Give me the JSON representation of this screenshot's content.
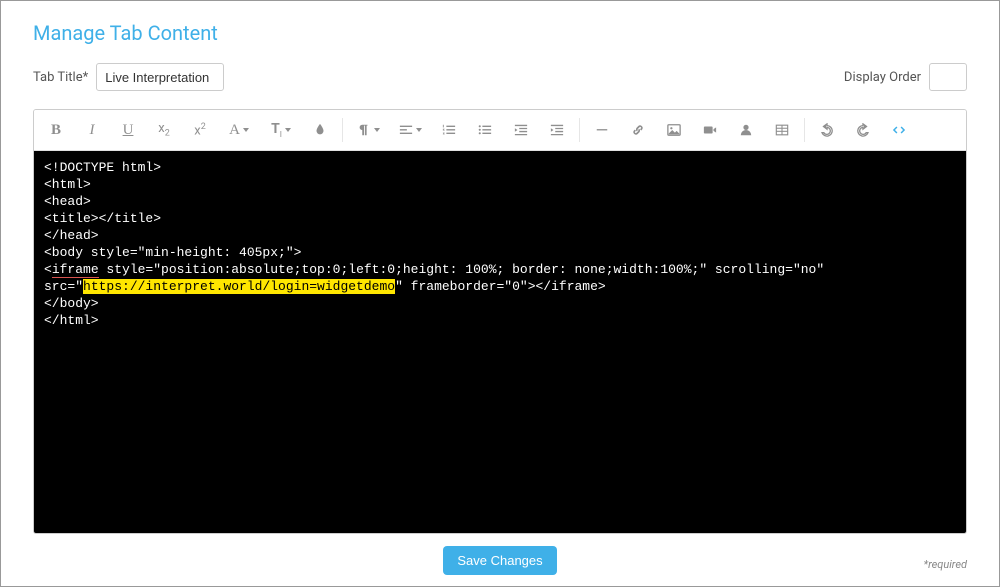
{
  "page_title": "Manage Tab Content",
  "tab_title": {
    "label": "Tab Title*",
    "value": "Live Interpretation"
  },
  "display_order": {
    "label": "Display Order",
    "value": ""
  },
  "toolbar": {
    "bold": "B",
    "italic": "I",
    "underline": "U",
    "subscript_base": "x",
    "subscript_sub": "2",
    "superscript_base": "x",
    "superscript_sup": "2",
    "font_family": "A",
    "font_size": "T",
    "font_size_sub": "I"
  },
  "code": {
    "line1": "<!DOCTYPE html>",
    "line2": "<html>",
    "line3": "<head>",
    "line4": "<title></title>",
    "line5": "</head>",
    "line6": "<body style=\"min-height: 405px;\">",
    "line7a": "<",
    "line7_iframe": "iframe",
    "line7b": " style=\"position:absolute;top:0;left:0;height: 100%; border: none;width:100%;\" scrolling=\"no\" ",
    "line8a": "src=\"",
    "line8_url": "https://interpret.world/login=widgetdemo",
    "line8b": "\" frameborder=\"0\"></iframe>",
    "line9": "</body>",
    "line10": "</html>"
  },
  "save_button_label": "Save Changes",
  "required_label": "*required"
}
